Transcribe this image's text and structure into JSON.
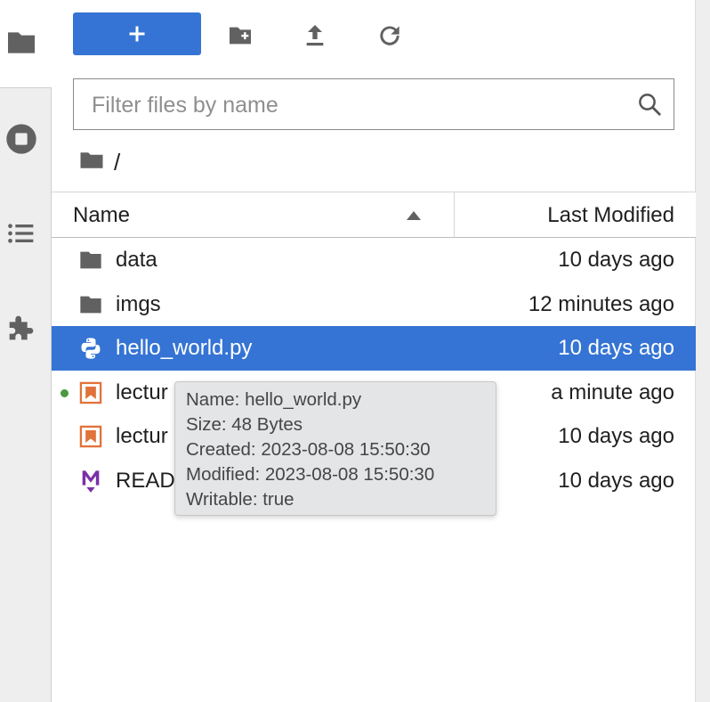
{
  "toolbar": {
    "new_label": "+",
    "new_folder_icon": "new-folder-icon",
    "upload_icon": "upload-icon",
    "refresh_icon": "refresh-icon"
  },
  "filter": {
    "placeholder": "Filter files by name",
    "value": ""
  },
  "breadcrumb": {
    "path": "/"
  },
  "columns": {
    "name": "Name",
    "modified": "Last Modified",
    "sort": "ascending"
  },
  "files": [
    {
      "name": "data",
      "modified": "10 days ago",
      "type": "folder",
      "icon": "folder-icon"
    },
    {
      "name": "imgs",
      "modified": "12 minutes ago",
      "type": "folder",
      "icon": "folder-icon"
    },
    {
      "name": "hello_world.py",
      "modified": "10 days ago",
      "type": "python",
      "icon": "python-icon",
      "selected": true
    },
    {
      "name": "lectur",
      "modified": "a minute ago",
      "type": "notebook",
      "icon": "notebook-icon",
      "running": true
    },
    {
      "name": "lectur",
      "modified": "10 days ago",
      "type": "notebook",
      "icon": "notebook-icon"
    },
    {
      "name": "READ",
      "modified": "10 days ago",
      "type": "markdown",
      "icon": "markdown-icon"
    }
  ],
  "tooltip": {
    "name": "Name: hello_world.py",
    "size": "Size: 48 Bytes",
    "created": "Created: 2023-08-08 15:50:30",
    "modified": "Modified: 2023-08-08 15:50:30",
    "writable": "Writable: true"
  },
  "sidebar": {
    "icons": [
      "folder-icon",
      "stop-circle-icon",
      "list-icon",
      "extension-puzzle-icon"
    ]
  },
  "colors": {
    "accent": "#3574d4",
    "selected_text": "#ffffff",
    "icon_gray": "#616161",
    "notebook_orange": "#e0733a",
    "markdown_purple": "#7b2fa6",
    "running_green": "#4a9a3d"
  }
}
